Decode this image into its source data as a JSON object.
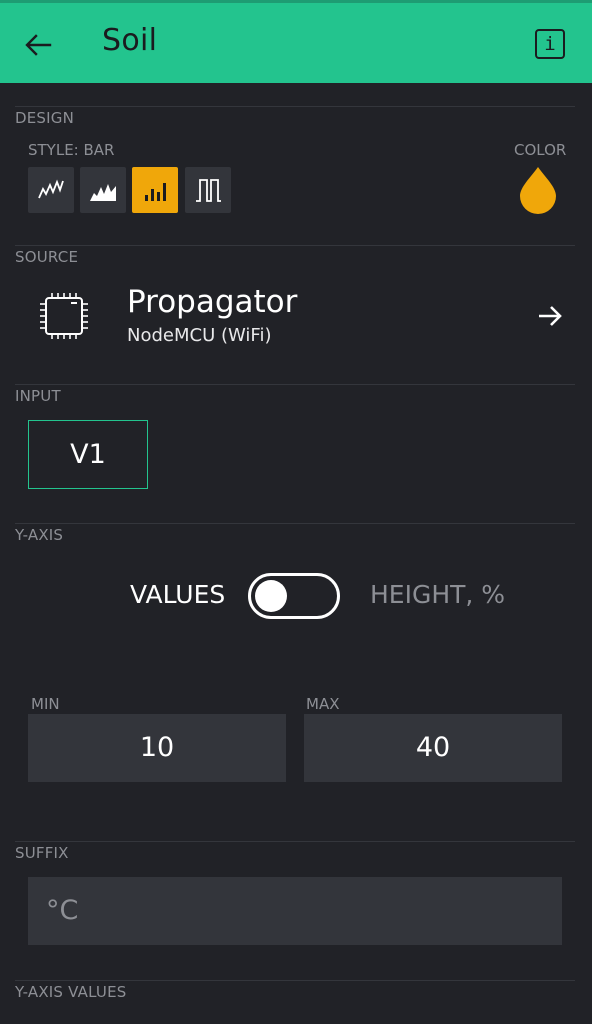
{
  "header": {
    "title": "Soil",
    "back_icon": "arrow-left-icon",
    "info_label": "i"
  },
  "design": {
    "section_label": "DESIGN",
    "style_label": "STYLE: BAR",
    "color_label": "COLOR",
    "accent_color": "#f0a70a",
    "styles": [
      {
        "icon": "line-chart-icon",
        "active": false
      },
      {
        "icon": "area-chart-icon",
        "active": false
      },
      {
        "icon": "bar-chart-icon",
        "active": true
      },
      {
        "icon": "binary-chart-icon",
        "active": false
      }
    ]
  },
  "source": {
    "section_label": "SOURCE",
    "device_name": "Propagator",
    "device_sub": "NodeMCU (WiFi)"
  },
  "input": {
    "section_label": "INPUT",
    "pin": "V1"
  },
  "y_axis": {
    "section_label": "Y-AXIS",
    "toggle_left": "VALUES",
    "toggle_right": "HEIGHT, %",
    "toggle_on": false,
    "min_label": "MIN",
    "min_value": "10",
    "max_label": "MAX",
    "max_value": "40"
  },
  "suffix": {
    "section_label": "SUFFIX",
    "value": "°C"
  },
  "y_axis_values": {
    "section_label": "Y-AXIS VALUES"
  },
  "colors": {
    "header": "#23c48e",
    "background": "#212227",
    "accent": "#f0a70a",
    "outline": "#23c48e"
  }
}
